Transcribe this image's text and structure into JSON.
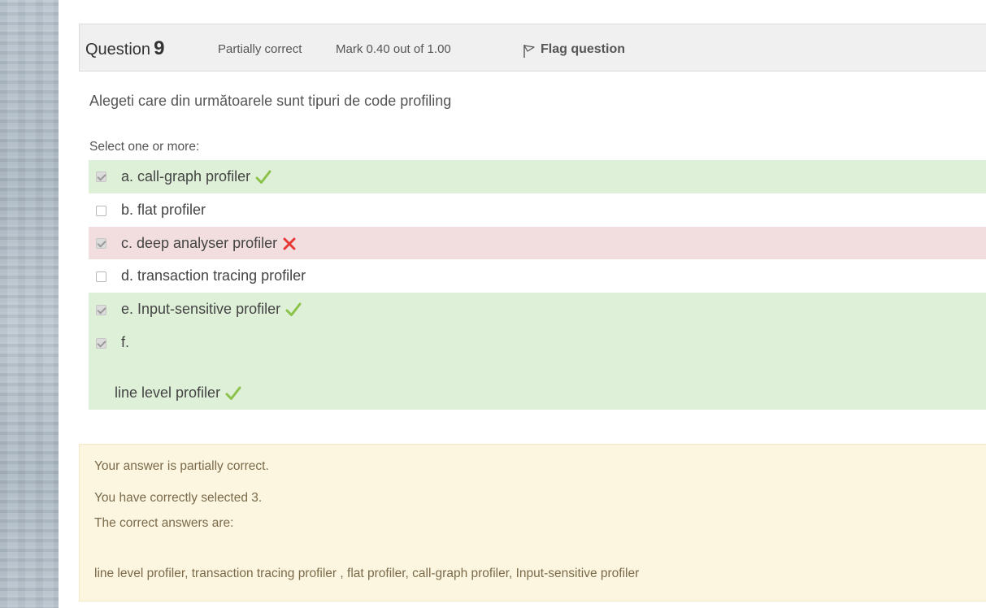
{
  "question": {
    "label": "Question",
    "number": "9",
    "state": "Partially correct",
    "grade": "Mark 0.40 out of 1.00",
    "flag_label": "Flag question",
    "text": "Alegeti care din următoarele sunt tipuri de code profiling",
    "prompt": "Select one or more:"
  },
  "answers": [
    {
      "label": "a. call-graph profiler",
      "checked": true,
      "status": "correct",
      "mark_icon": "check-icon"
    },
    {
      "label": "b. flat profiler",
      "checked": false,
      "status": "none"
    },
    {
      "label": "c. deep analyser profiler",
      "checked": true,
      "status": "incorrect",
      "mark_icon": "cross-icon"
    },
    {
      "label": "d. transaction tracing profiler",
      "checked": false,
      "status": "none"
    },
    {
      "label": "e. Input-sensitive profiler",
      "checked": true,
      "status": "correct",
      "mark_icon": "check-icon"
    },
    {
      "label": "f.",
      "extra": "line level profiler",
      "checked": true,
      "status": "correct",
      "mark_icon": "check-icon"
    }
  ],
  "feedback": {
    "summary": "Your answer is partially correct.",
    "selected": "You have correctly selected 3.",
    "correct_heading": "The correct answers are:",
    "correct_list": "line level profiler, transaction tracing profiler , flat profiler, call-graph profiler, Input-sensitive profiler"
  },
  "colors": {
    "correct_bg": "#dff0d8",
    "incorrect_bg": "#f2dede",
    "feedback_bg": "#fcf6e1",
    "check": "#8bc34a",
    "cross": "#e53935"
  }
}
